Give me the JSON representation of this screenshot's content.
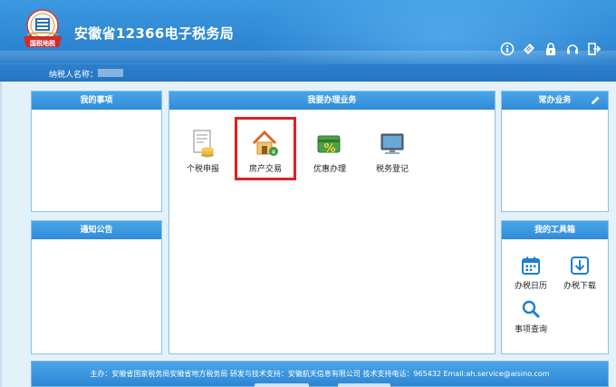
{
  "header": {
    "site_title": "安徽省12366电子税务局",
    "emblem_text": "国税地税",
    "toolbar_icons": [
      "info-icon",
      "ticket-icon",
      "lock-icon",
      "headset-icon",
      "logout-icon"
    ]
  },
  "taxpayer": {
    "label": "纳税人名称："
  },
  "panels": {
    "my_items": {
      "title": "我的事项"
    },
    "notices": {
      "title": "通知公告"
    },
    "business": {
      "title": "我要办理业务",
      "items": [
        {
          "label": "个税申报",
          "icon": "tax-form-icon"
        },
        {
          "label": "房产交易",
          "icon": "house-money-icon"
        },
        {
          "label": "优惠办理",
          "icon": "discount-icon"
        },
        {
          "label": "税务登记",
          "icon": "computer-icon"
        }
      ]
    },
    "frequent": {
      "title": "常办业务"
    },
    "toolbox": {
      "title": "我的工具箱",
      "items": [
        {
          "label": "办税日历",
          "icon": "calendar-icon"
        },
        {
          "label": "办税下载",
          "icon": "download-icon"
        },
        {
          "label": "事项查询",
          "icon": "search-icon"
        }
      ]
    }
  },
  "footer": {
    "text": "主办：安徽省国家税务局安徽省地方税务局   研发与技术支持：安徽航天信息有限公司 技术支持电话：965432 Email:ah.service@aisino.com"
  },
  "colors": {
    "header_blue": "#2d84d1",
    "panel_head_blue": "#2f8bd8",
    "highlight_red": "#e02020",
    "background": "#e3f1fb"
  }
}
